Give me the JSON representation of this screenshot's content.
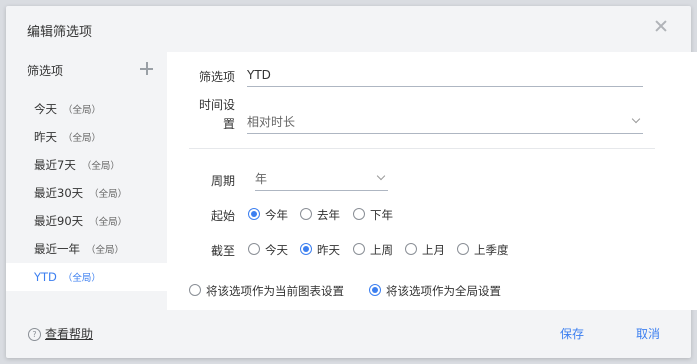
{
  "dialog": {
    "title": "编辑筛选项"
  },
  "sidebar": {
    "title": "筛选项",
    "items": [
      {
        "label": "今天",
        "tag": "（全局）"
      },
      {
        "label": "昨天",
        "tag": "（全局）"
      },
      {
        "label": "最近7天",
        "tag": "（全局）"
      },
      {
        "label": "最近30天",
        "tag": "（全局）"
      },
      {
        "label": "最近90天",
        "tag": "（全局）"
      },
      {
        "label": "最近一年",
        "tag": "（全局）"
      },
      {
        "label": "YTD",
        "tag": "（全局）"
      }
    ],
    "selected_index": 6
  },
  "form": {
    "name_label": "筛选项",
    "name_value": "YTD",
    "time_label_line1": "时间设",
    "time_label_line2": "置",
    "time_value": "相对时长",
    "period_label": "周期",
    "period_value": "年",
    "start_label": "起始",
    "start_options": [
      "今年",
      "去年",
      "下年"
    ],
    "start_selected": 0,
    "end_label": "截至",
    "end_options": [
      "今天",
      "昨天",
      "上周",
      "上月",
      "上季度"
    ],
    "end_selected": 1,
    "scope_options": [
      "将该选项作为当前图表设置",
      "将该选项作为全局设置"
    ],
    "scope_selected": 1
  },
  "footer": {
    "help_label": "查看帮助",
    "help_icon": "?",
    "save_label": "保存",
    "cancel_label": "取消"
  },
  "colors": {
    "accent": "#3c7ff0",
    "panel": "#ffffff",
    "dialog_bg": "#f3f4f6"
  }
}
